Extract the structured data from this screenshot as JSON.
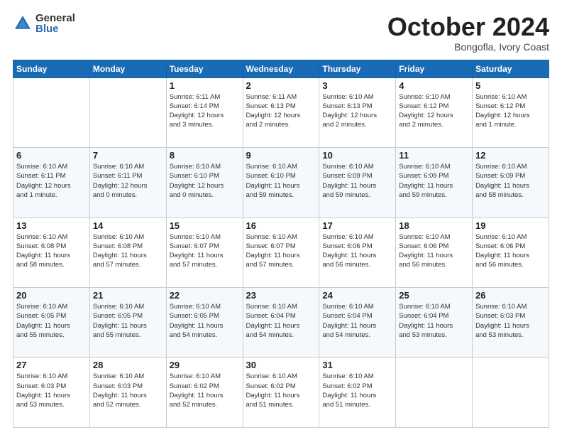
{
  "logo": {
    "general": "General",
    "blue": "Blue"
  },
  "header": {
    "month": "October 2024",
    "location": "Bongofla, Ivory Coast"
  },
  "weekdays": [
    "Sunday",
    "Monday",
    "Tuesday",
    "Wednesday",
    "Thursday",
    "Friday",
    "Saturday"
  ],
  "weeks": [
    [
      {
        "day": "",
        "info": ""
      },
      {
        "day": "",
        "info": ""
      },
      {
        "day": "1",
        "info": "Sunrise: 6:11 AM\nSunset: 6:14 PM\nDaylight: 12 hours\nand 3 minutes."
      },
      {
        "day": "2",
        "info": "Sunrise: 6:11 AM\nSunset: 6:13 PM\nDaylight: 12 hours\nand 2 minutes."
      },
      {
        "day": "3",
        "info": "Sunrise: 6:10 AM\nSunset: 6:13 PM\nDaylight: 12 hours\nand 2 minutes."
      },
      {
        "day": "4",
        "info": "Sunrise: 6:10 AM\nSunset: 6:12 PM\nDaylight: 12 hours\nand 2 minutes."
      },
      {
        "day": "5",
        "info": "Sunrise: 6:10 AM\nSunset: 6:12 PM\nDaylight: 12 hours\nand 1 minute."
      }
    ],
    [
      {
        "day": "6",
        "info": "Sunrise: 6:10 AM\nSunset: 6:11 PM\nDaylight: 12 hours\nand 1 minute."
      },
      {
        "day": "7",
        "info": "Sunrise: 6:10 AM\nSunset: 6:11 PM\nDaylight: 12 hours\nand 0 minutes."
      },
      {
        "day": "8",
        "info": "Sunrise: 6:10 AM\nSunset: 6:10 PM\nDaylight: 12 hours\nand 0 minutes."
      },
      {
        "day": "9",
        "info": "Sunrise: 6:10 AM\nSunset: 6:10 PM\nDaylight: 11 hours\nand 59 minutes."
      },
      {
        "day": "10",
        "info": "Sunrise: 6:10 AM\nSunset: 6:09 PM\nDaylight: 11 hours\nand 59 minutes."
      },
      {
        "day": "11",
        "info": "Sunrise: 6:10 AM\nSunset: 6:09 PM\nDaylight: 11 hours\nand 59 minutes."
      },
      {
        "day": "12",
        "info": "Sunrise: 6:10 AM\nSunset: 6:09 PM\nDaylight: 11 hours\nand 58 minutes."
      }
    ],
    [
      {
        "day": "13",
        "info": "Sunrise: 6:10 AM\nSunset: 6:08 PM\nDaylight: 11 hours\nand 58 minutes."
      },
      {
        "day": "14",
        "info": "Sunrise: 6:10 AM\nSunset: 6:08 PM\nDaylight: 11 hours\nand 57 minutes."
      },
      {
        "day": "15",
        "info": "Sunrise: 6:10 AM\nSunset: 6:07 PM\nDaylight: 11 hours\nand 57 minutes."
      },
      {
        "day": "16",
        "info": "Sunrise: 6:10 AM\nSunset: 6:07 PM\nDaylight: 11 hours\nand 57 minutes."
      },
      {
        "day": "17",
        "info": "Sunrise: 6:10 AM\nSunset: 6:06 PM\nDaylight: 11 hours\nand 56 minutes."
      },
      {
        "day": "18",
        "info": "Sunrise: 6:10 AM\nSunset: 6:06 PM\nDaylight: 11 hours\nand 56 minutes."
      },
      {
        "day": "19",
        "info": "Sunrise: 6:10 AM\nSunset: 6:06 PM\nDaylight: 11 hours\nand 56 minutes."
      }
    ],
    [
      {
        "day": "20",
        "info": "Sunrise: 6:10 AM\nSunset: 6:05 PM\nDaylight: 11 hours\nand 55 minutes."
      },
      {
        "day": "21",
        "info": "Sunrise: 6:10 AM\nSunset: 6:05 PM\nDaylight: 11 hours\nand 55 minutes."
      },
      {
        "day": "22",
        "info": "Sunrise: 6:10 AM\nSunset: 6:05 PM\nDaylight: 11 hours\nand 54 minutes."
      },
      {
        "day": "23",
        "info": "Sunrise: 6:10 AM\nSunset: 6:04 PM\nDaylight: 11 hours\nand 54 minutes."
      },
      {
        "day": "24",
        "info": "Sunrise: 6:10 AM\nSunset: 6:04 PM\nDaylight: 11 hours\nand 54 minutes."
      },
      {
        "day": "25",
        "info": "Sunrise: 6:10 AM\nSunset: 6:04 PM\nDaylight: 11 hours\nand 53 minutes."
      },
      {
        "day": "26",
        "info": "Sunrise: 6:10 AM\nSunset: 6:03 PM\nDaylight: 11 hours\nand 53 minutes."
      }
    ],
    [
      {
        "day": "27",
        "info": "Sunrise: 6:10 AM\nSunset: 6:03 PM\nDaylight: 11 hours\nand 53 minutes."
      },
      {
        "day": "28",
        "info": "Sunrise: 6:10 AM\nSunset: 6:03 PM\nDaylight: 11 hours\nand 52 minutes."
      },
      {
        "day": "29",
        "info": "Sunrise: 6:10 AM\nSunset: 6:02 PM\nDaylight: 11 hours\nand 52 minutes."
      },
      {
        "day": "30",
        "info": "Sunrise: 6:10 AM\nSunset: 6:02 PM\nDaylight: 11 hours\nand 51 minutes."
      },
      {
        "day": "31",
        "info": "Sunrise: 6:10 AM\nSunset: 6:02 PM\nDaylight: 11 hours\nand 51 minutes."
      },
      {
        "day": "",
        "info": ""
      },
      {
        "day": "",
        "info": ""
      }
    ]
  ]
}
